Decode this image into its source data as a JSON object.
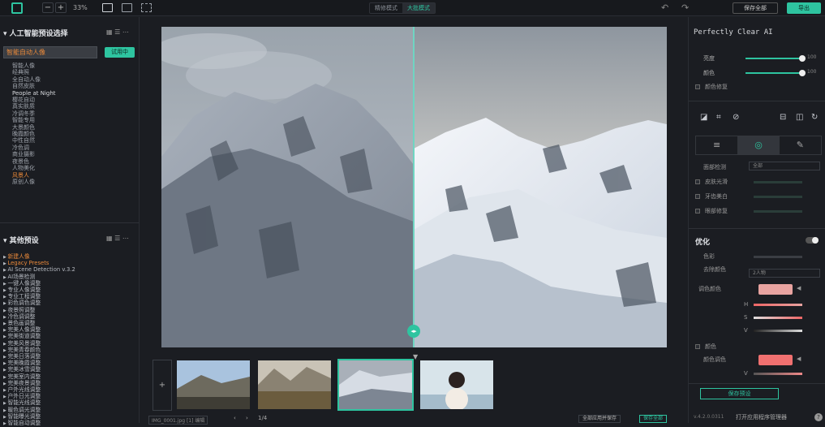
{
  "topbar": {
    "zoom_minus": "−",
    "zoom_plus": "+",
    "zoom_level": "33%",
    "mode_tabs": [
      "精修模式",
      "大批模式"
    ],
    "btn_save_all": "保存全部",
    "btn_export": "导出"
  },
  "left_panel": {
    "ai_section_title": "人工智能预设选择",
    "preset_selected": "智能自动人像",
    "preset_button": "试用中",
    "presets": [
      "智能人像",
      "经典照",
      "全自动人像",
      "自然皮肤",
      "People at Night",
      "樱花自动",
      "真实肤质",
      "冷调冬季",
      "智能专用",
      "大景颜色",
      "晚霞颜色",
      "中性自然",
      "冷色调",
      "商业摄影",
      "夜景色",
      "人物美化",
      "风景人",
      "原创人像"
    ],
    "other_section_title": "其他预设",
    "other_presets": [
      "新建人像",
      "Legacy Presets",
      "AI Scene Detection v.3.2",
      "AI场景检测",
      "一键人像调整",
      "专业人像调整",
      "专业工程调整",
      "彩色调色调整",
      "夜景照调整",
      "冷色调调整",
      "景色画调整",
      "完美人像调整",
      "完美街道调整",
      "完美风景调整",
      "完美青春颜色",
      "完美日落调整",
      "完美晚霞调整",
      "完美冰雪调整",
      "完美室内调整",
      "完美夜景调整",
      "户外光线调整",
      "户外日光调整",
      "智能光线调整",
      "暖色调光调整",
      "智能曝光调整",
      "智能自动调整"
    ]
  },
  "right_panel": {
    "title": "Perfectly Clear AI",
    "sliders_top": [
      {
        "label": "亮度",
        "value": 100,
        "display": "100"
      },
      {
        "label": "颜色",
        "value": 100,
        "display": "100"
      }
    ],
    "check_top": "颜色修复",
    "tabs": [
      "adjust-icon",
      "ai-icon",
      "retouch-icon"
    ],
    "dropdown_label": "面部检测",
    "dropdown_value": "全部",
    "checks_mid": [
      "皮肤光滑",
      "牙齿美白",
      "眼部修复"
    ],
    "section_title": "优化",
    "opt_label1": "色彩",
    "opt_label2": "去除颜色",
    "opt_dd_value": "2人物",
    "color_label": "调色颜色",
    "sliders_color": [
      {
        "label": "H",
        "value": 80
      },
      {
        "label": "S",
        "value": 60
      },
      {
        "label": "V",
        "value": 70
      }
    ],
    "check_bottom": "颜色",
    "color2_label": "颜色调色",
    "slider_bottom": {
      "label": "V",
      "value": 60
    },
    "apply_button": "保存预设",
    "version": "v.4.2.0.0311",
    "manage": "打开应用程序管理器",
    "help": "?"
  },
  "bottombar": {
    "status": "IMG_0001.jpg  [1]  编辑",
    "pager_prev": "‹",
    "pager_next": "›",
    "pager_label": "1/4",
    "btn_apply_all": "全部应用并保存",
    "btn_save": "保存全部"
  },
  "colors": {
    "accent": "#2ec4a0",
    "orange": "#e9893a",
    "swatch_skin": "#e8a3a0",
    "swatch_red": "#f07070"
  }
}
